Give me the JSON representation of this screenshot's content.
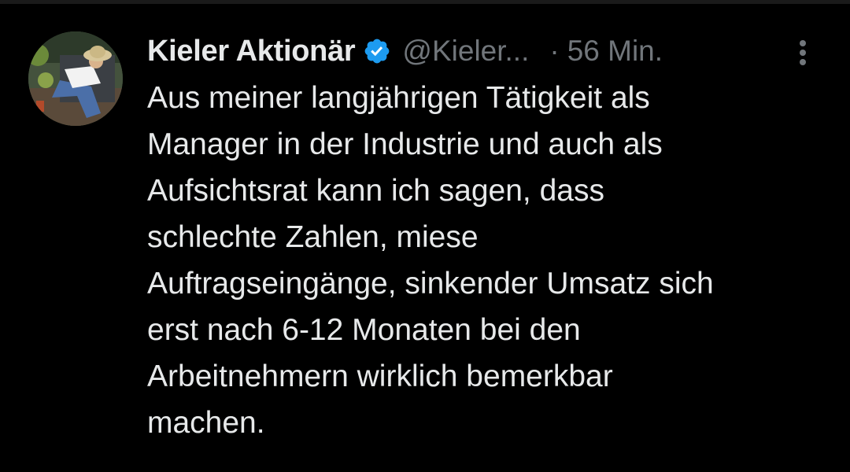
{
  "tweet": {
    "display_name": "Kieler Aktionär",
    "verified": true,
    "handle": "@Kieler...",
    "separator": "·",
    "timestamp": "56 Min.",
    "text_lines": [
      "Aus meiner langjährigen Tätigkeit als",
      "Manager in der Industrie und auch als",
      "Aufsichtsrat kann ich sagen, dass",
      "schlechte Zahlen, miese",
      "Auftragseingänge, sinkender Umsatz sich",
      "erst nach 6-12 Monaten bei den",
      "Arbeitnehmern wirklich bemerkbar",
      "machen."
    ]
  },
  "icons": {
    "verified": "verified-badge-icon",
    "more": "more-vertical-icon"
  },
  "colors": {
    "background": "#000000",
    "primary_text": "#e7e9ea",
    "secondary_text": "#71767b",
    "verified_blue": "#1d9bf0"
  }
}
